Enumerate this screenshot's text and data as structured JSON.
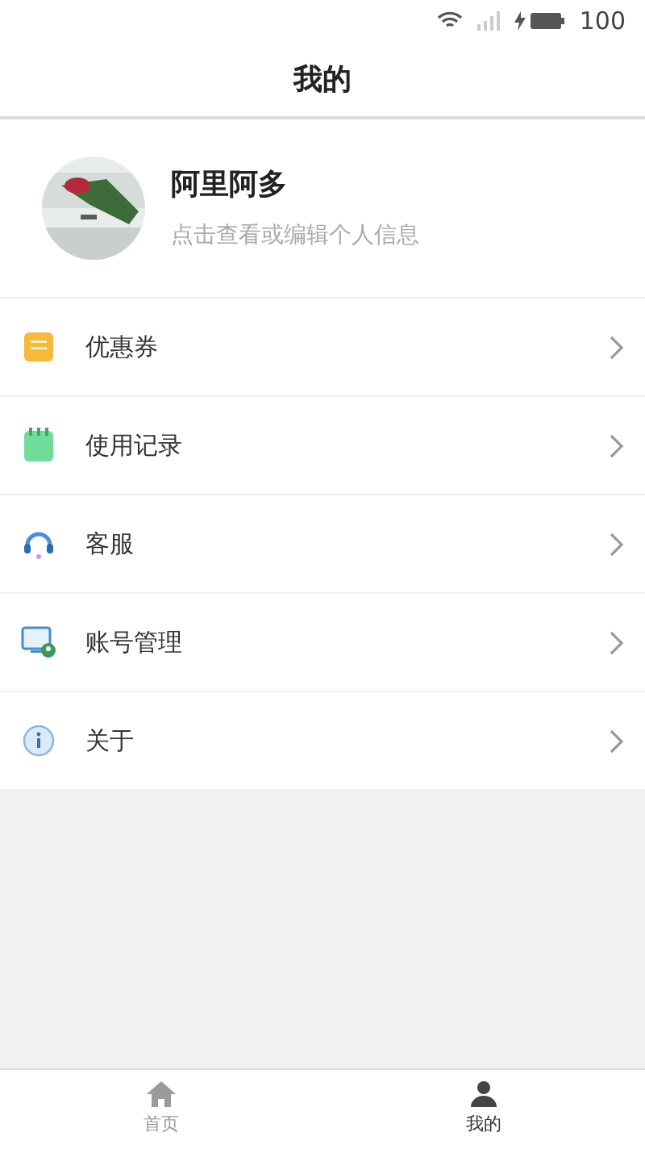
{
  "status_bar": {
    "battery": "100"
  },
  "header": {
    "title": "我的"
  },
  "profile": {
    "name": "阿里阿多",
    "hint": "点击查看或编辑个人信息"
  },
  "menu": [
    {
      "kind": "coupon",
      "label": "优惠券"
    },
    {
      "kind": "notebook",
      "label": "使用记录"
    },
    {
      "kind": "headset",
      "label": "客服"
    },
    {
      "kind": "account",
      "label": "账号管理"
    },
    {
      "kind": "info",
      "label": "关于"
    }
  ],
  "tab_bar": [
    {
      "kind": "home",
      "label": "首页",
      "selected": false
    },
    {
      "kind": "user",
      "label": "我的",
      "selected": true
    }
  ]
}
